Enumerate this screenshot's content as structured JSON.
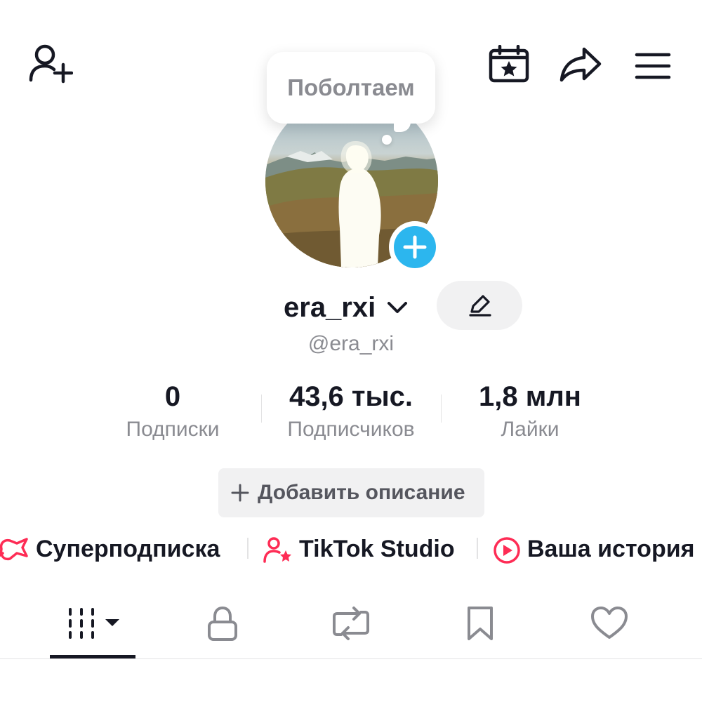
{
  "bubble": {
    "text": "Поболтаем"
  },
  "profile": {
    "display_name": "era_rxi",
    "handle": "@era_rxi"
  },
  "stats": [
    {
      "value": "0",
      "label": "Подписки"
    },
    {
      "value": "43,6 тыс.",
      "label": "Подписчиков"
    },
    {
      "value": "1,8 млн",
      "label": "Лайки"
    }
  ],
  "add_description": {
    "label": "Добавить описание"
  },
  "shortcuts": [
    {
      "label": "Суперподписка",
      "icon": "superfollow-icon"
    },
    {
      "label": "TikTok Studio",
      "icon": "creator-star-icon"
    },
    {
      "label": "Ваша история",
      "icon": "play-circle-icon"
    }
  ],
  "tabs": [
    {
      "icon": "videos-grid-icon",
      "selected": true
    },
    {
      "icon": "lock-icon",
      "selected": false
    },
    {
      "icon": "repost-icon",
      "selected": false
    },
    {
      "icon": "bookmark-icon",
      "selected": false
    },
    {
      "icon": "heart-icon",
      "selected": false
    }
  ],
  "colors": {
    "text_primary": "#161823",
    "text_secondary": "#8a8b91",
    "accent_red": "#fe2c55",
    "story_blue": "#2cb6ee",
    "button_bg": "#f1f1f2"
  }
}
